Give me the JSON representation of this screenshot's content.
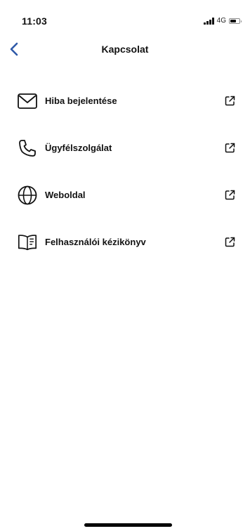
{
  "status_bar": {
    "time": "11:03",
    "network": "4G",
    "battery_level": 0.7
  },
  "nav": {
    "title": "Kapcsolat",
    "back_icon": "chevron-left-icon",
    "accent_color": "#2f5aa8"
  },
  "menu": {
    "items": [
      {
        "label": "Hiba bejelentése",
        "icon": "envelope-icon",
        "action_icon": "external-link-icon"
      },
      {
        "label": "Ügyfélszolgálat",
        "icon": "phone-icon",
        "action_icon": "external-link-icon"
      },
      {
        "label": "Weboldal",
        "icon": "globe-icon",
        "action_icon": "external-link-icon"
      },
      {
        "label": "Felhasználói kézikönyv",
        "icon": "manual-book-icon",
        "action_icon": "external-link-icon"
      }
    ]
  }
}
